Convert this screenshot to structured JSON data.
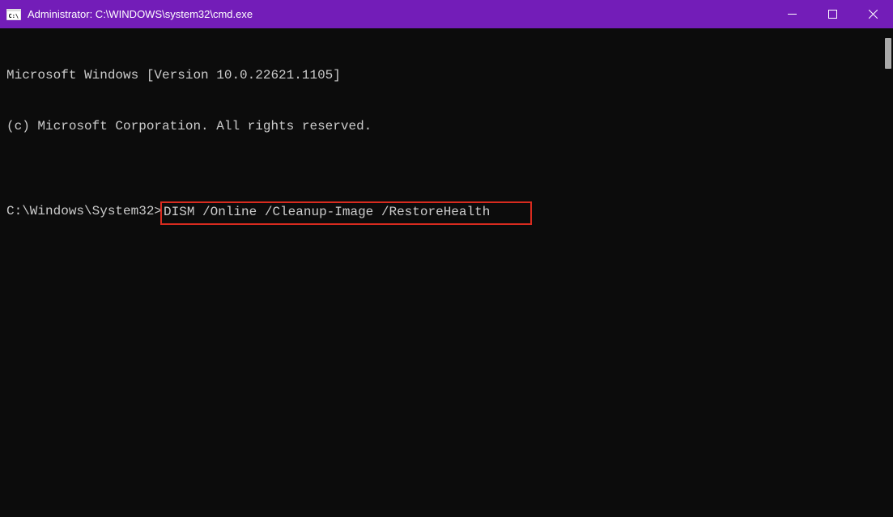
{
  "titlebar": {
    "title": "Administrator: C:\\WINDOWS\\system32\\cmd.exe"
  },
  "terminal": {
    "line1": "Microsoft Windows [Version 10.0.22621.1105]",
    "line2": "(c) Microsoft Corporation. All rights reserved.",
    "blank": "",
    "prompt": "C:\\Windows\\System32>",
    "command": "DISM /Online /Cleanup-Image /RestoreHealth     "
  }
}
